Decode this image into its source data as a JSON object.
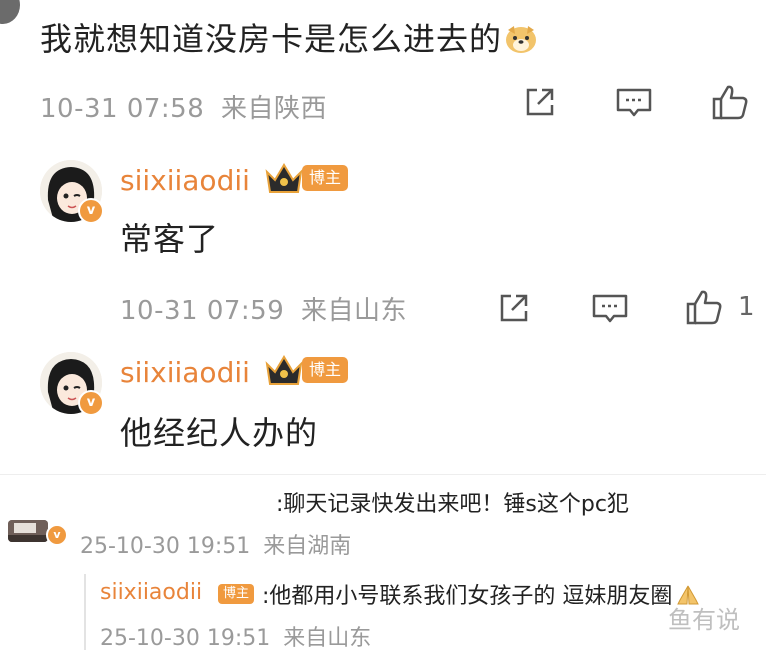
{
  "top_comment": {
    "text": "我就想知道没房卡是怎么进去的",
    "emoji": "doge-emoji",
    "time": "10-31 07:58",
    "location": "来自陕西"
  },
  "replies": [
    {
      "username": "siixiiaodii",
      "badge": "博主",
      "text": "常客了",
      "time": "10-31 07:59",
      "location": "来自山东",
      "like_count": "1"
    },
    {
      "username": "siixiiaodii",
      "badge": "博主",
      "text": "他经纪人办的"
    }
  ],
  "thread": {
    "quote_text": ":聊天记录快发出来吧！锤s这个pc犯",
    "time": "25-10-30 19:51",
    "location": "来自湖南",
    "nested_reply": {
      "username": "siixiiaodii",
      "badge": "博主",
      "text": ":他都用小号联系我们女孩子的 逗妹朋友圈",
      "time": "25-10-30 19:51",
      "location": "来自山东"
    }
  },
  "watermark": "鱼有说",
  "colors": {
    "accent": "#e8843a",
    "badge": "#f09a3f",
    "meta": "#9a9a9a"
  }
}
